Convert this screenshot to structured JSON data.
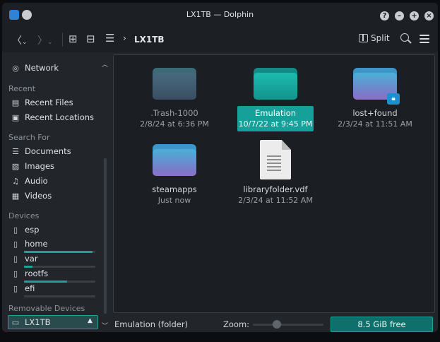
{
  "window": {
    "title": "LX1TB — Dolphin",
    "accent": "#16a09a"
  },
  "titlebar": {
    "help": "?",
    "minimize": "–",
    "maximize": "+",
    "close": "×"
  },
  "toolbar": {
    "back": "〈",
    "forward": "〉",
    "breadcrumb_arrow": "›",
    "breadcrumb": "LX1TB",
    "split_label": "Split"
  },
  "sidebar": {
    "network": "Network",
    "recent_header": "Recent",
    "recent_files": "Recent Files",
    "recent_locations": "Recent Locations",
    "search_header": "Search For",
    "documents": "Documents",
    "images": "Images",
    "audio": "Audio",
    "videos": "Videos",
    "devices_header": "Devices",
    "devices": [
      {
        "label": "esp",
        "usage": 0
      },
      {
        "label": "home",
        "usage": 0.96
      },
      {
        "label": "var",
        "usage": 0.12
      },
      {
        "label": "rootfs",
        "usage": 0.6
      },
      {
        "label": "efi",
        "usage": 0.0
      }
    ],
    "removable_header": "Removable Devices",
    "removable": {
      "label": "LX1TB",
      "eject": "▲"
    }
  },
  "files": [
    {
      "name": ".Trash-1000",
      "date": "2/8/24 at 6:36 PM",
      "kind": "folder-dim"
    },
    {
      "name": "Emulation",
      "date": "10/7/22 at 9:45 PM",
      "kind": "folder-teal",
      "selected": true
    },
    {
      "name": "lost+found",
      "date": "2/3/24 at 11:51 AM",
      "kind": "folder-locked"
    },
    {
      "name": "steamapps",
      "date": "Just now",
      "kind": "folder"
    },
    {
      "name": "libraryfolder.vdf",
      "date": "2/3/24 at 11:52 AM",
      "kind": "text-file"
    }
  ],
  "statusbar": {
    "selection": "Emulation (folder)",
    "zoom_label": "Zoom:",
    "free_space": "8.5 GiB free"
  }
}
